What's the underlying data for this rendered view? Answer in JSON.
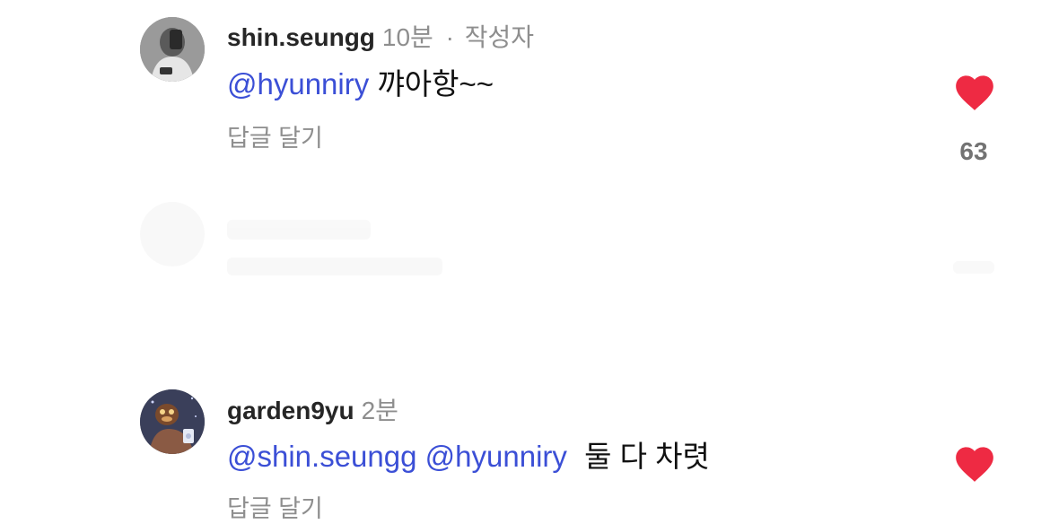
{
  "comments": [
    {
      "username": "shin.seungg",
      "time": "10분",
      "separator": "·",
      "author_badge": "작성자",
      "mention": "@hyunniry",
      "text": "꺄아항~~",
      "reply_label": "답글 달기",
      "likes": "63",
      "liked": true
    },
    {
      "username": "garden9yu",
      "time": "2분",
      "mention1": "@shin.seungg",
      "mention2": "@hyunniry",
      "text": "둘 다 차렷",
      "reply_label": "답글 달기",
      "liked": true
    }
  ],
  "colors": {
    "mention": "#3b4fd6",
    "heart": "#ee2a43",
    "meta": "#8e8e8e"
  },
  "icons": [
    "heart-icon",
    "avatar"
  ]
}
